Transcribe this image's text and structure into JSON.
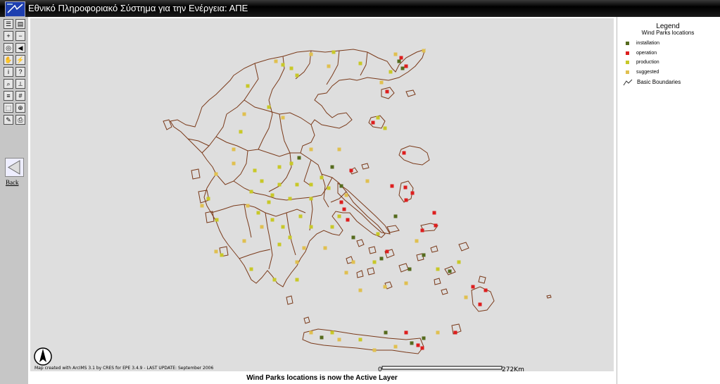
{
  "window": {
    "title": "Εθνικό Πληροφοριακό Σύστημα για την Ενέργεια: ΑΠΕ"
  },
  "toolbar": {
    "tools": [
      {
        "name": "toc-icon",
        "glyph": "☰"
      },
      {
        "name": "legend-icon",
        "glyph": "▤"
      },
      {
        "name": "zoom-in-icon",
        "glyph": "+"
      },
      {
        "name": "zoom-out-icon",
        "glyph": "−"
      },
      {
        "name": "full-extent-icon",
        "glyph": "◎"
      },
      {
        "name": "zoom-back-icon",
        "glyph": "◀"
      },
      {
        "name": "pan-icon",
        "glyph": "✋"
      },
      {
        "name": "hyperlink-icon",
        "glyph": "⚡"
      },
      {
        "name": "identify-icon",
        "glyph": "i"
      },
      {
        "name": "query-icon",
        "glyph": "?"
      },
      {
        "name": "find-icon",
        "glyph": "⌕"
      },
      {
        "name": "measure-icon",
        "glyph": "⟂"
      },
      {
        "name": "buffer-icon",
        "glyph": "≡"
      },
      {
        "name": "grid-icon",
        "glyph": "#"
      },
      {
        "name": "select-rect-icon",
        "glyph": "⬚"
      },
      {
        "name": "select-icon",
        "glyph": "⊕"
      },
      {
        "name": "clear-icon",
        "glyph": "✎"
      },
      {
        "name": "print-icon",
        "glyph": "⎙"
      }
    ],
    "back_label": "Back"
  },
  "map": {
    "credit": "Map created with ArcIMS 3.1 by CRES for EPE 3.4.9 - LAST UPDATE: September 2006",
    "scale_start": "0",
    "scale_end": "272Km"
  },
  "status": "Wind Parks locations is now the Active Layer",
  "legend": {
    "title": "Legend",
    "layer": "Wind Parks locations",
    "items": [
      {
        "label": "installation",
        "color": "#556b1e"
      },
      {
        "label": "operation",
        "color": "#dd1e1e"
      },
      {
        "label": "production",
        "color": "#c8c828"
      },
      {
        "label": "suggested",
        "color": "#e0c050"
      }
    ],
    "boundaries": "Basic Boundaries"
  },
  "colors": {
    "boundary": "#7a3a1a",
    "map_bg": "#dedede"
  },
  "wind_parks": {
    "installation": [
      [
        565,
        85
      ],
      [
        570,
        95
      ],
      [
        423,
        222
      ],
      [
        470,
        235
      ],
      [
        483,
        262
      ],
      [
        560,
        305
      ],
      [
        500,
        335
      ],
      [
        540,
        365
      ],
      [
        580,
        380
      ],
      [
        600,
        360
      ],
      [
        455,
        477
      ],
      [
        546,
        470
      ],
      [
        583,
        485
      ],
      [
        600,
        478
      ],
      [
        637,
        383
      ]
    ],
    "operation": [
      [
        568,
        80
      ],
      [
        575,
        92
      ],
      [
        548,
        128
      ],
      [
        528,
        172
      ],
      [
        572,
        215
      ],
      [
        497,
        240
      ],
      [
        555,
        262
      ],
      [
        574,
        264
      ],
      [
        584,
        272
      ],
      [
        575,
        282
      ],
      [
        483,
        285
      ],
      [
        487,
        295
      ],
      [
        492,
        310
      ],
      [
        598,
        325
      ],
      [
        617,
        318
      ],
      [
        548,
        355
      ],
      [
        670,
        405
      ],
      [
        680,
        430
      ],
      [
        688,
        410
      ],
      [
        598,
        492
      ],
      [
        592,
        488
      ],
      [
        575,
        470
      ],
      [
        645,
        470
      ],
      [
        615,
        300
      ]
    ],
    "production": [
      [
        400,
        90
      ],
      [
        412,
        95
      ],
      [
        472,
        72
      ],
      [
        510,
        88
      ],
      [
        553,
        100
      ],
      [
        420,
        105
      ],
      [
        350,
        120
      ],
      [
        380,
        150
      ],
      [
        340,
        185
      ],
      [
        412,
        230
      ],
      [
        395,
        235
      ],
      [
        360,
        240
      ],
      [
        370,
        255
      ],
      [
        395,
        260
      ],
      [
        420,
        260
      ],
      [
        440,
        260
      ],
      [
        455,
        250
      ],
      [
        465,
        265
      ],
      [
        355,
        270
      ],
      [
        385,
        275
      ],
      [
        410,
        280
      ],
      [
        440,
        280
      ],
      [
        365,
        300
      ],
      [
        385,
        310
      ],
      [
        400,
        320
      ],
      [
        410,
        335
      ],
      [
        395,
        345
      ],
      [
        440,
        320
      ],
      [
        470,
        320
      ],
      [
        355,
        380
      ],
      [
        388,
        395
      ],
      [
        420,
        395
      ],
      [
        294,
        280
      ],
      [
        306,
        310
      ],
      [
        313,
        360
      ],
      [
        535,
        330
      ],
      [
        530,
        370
      ],
      [
        535,
        165
      ],
      [
        545,
        180
      ],
      [
        620,
        380
      ],
      [
        650,
        370
      ],
      [
        470,
        470
      ],
      [
        510,
        480
      ],
      [
        425,
        305
      ],
      [
        380,
        285
      ],
      [
        480,
        305
      ]
    ],
    "suggested": [
      [
        390,
        85
      ],
      [
        440,
        75
      ],
      [
        465,
        92
      ],
      [
        540,
        115
      ],
      [
        560,
        75
      ],
      [
        600,
        70
      ],
      [
        345,
        160
      ],
      [
        400,
        165
      ],
      [
        330,
        210
      ],
      [
        440,
        210
      ],
      [
        480,
        210
      ],
      [
        350,
        290
      ],
      [
        370,
        320
      ],
      [
        345,
        340
      ],
      [
        305,
        355
      ],
      [
        430,
        350
      ],
      [
        460,
        350
      ],
      [
        500,
        370
      ],
      [
        545,
        405
      ],
      [
        590,
        340
      ],
      [
        520,
        255
      ],
      [
        490,
        275
      ],
      [
        305,
        245
      ],
      [
        285,
        290
      ],
      [
        330,
        230
      ],
      [
        420,
        370
      ],
      [
        440,
        470
      ],
      [
        480,
        480
      ],
      [
        530,
        495
      ],
      [
        560,
        490
      ],
      [
        620,
        470
      ],
      [
        660,
        420
      ],
      [
        575,
        400
      ],
      [
        490,
        385
      ],
      [
        510,
        410
      ]
    ]
  }
}
